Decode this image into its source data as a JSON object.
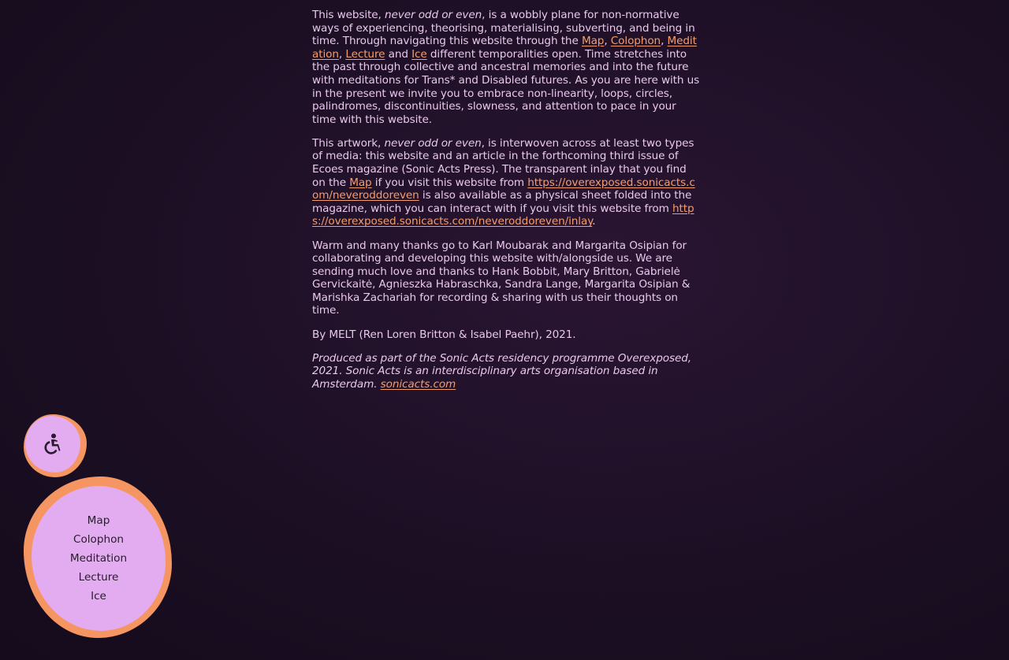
{
  "intro": {
    "p1_a": "This website, ",
    "p1_em": "never odd or even",
    "p1_b": ", is a wobbly plane for non-normative ways of experiencing, theorising, materialising, subverting, and being in time. Through navigating this website through the ",
    "p1_link_map": "Map",
    "p1_sep1": ", ",
    "p1_link_colophon": "Colophon",
    "p1_sep2": ", ",
    "p1_link_meditation": "Meditation",
    "p1_sep3": ", ",
    "p1_link_lecture": "Lecture",
    "p1_and": " and ",
    "p1_link_ice": "Ice",
    "p1_c": " different temporalities open. Time stretches into the past through collective and ancestral memories and into the future with meditations for Trans* and Disabled futures. As you are here with us in the present we invite you to embrace non-linearity, loops, circles, palindromes, discontinuities, slowness, and attention to pace in your time with this website.",
    "p2_a": "This artwork, ",
    "p2_em": "never odd or even",
    "p2_b": ", is interwoven across at least two types of media: this website and an article in the forthcoming third issue of Ecoes magazine (Sonic Acts Press). The transparent inlay that you find on the ",
    "p2_link_map": "Map",
    "p2_c": " if you visit this website from ",
    "p2_link_url1": "https://overexposed.sonicacts.com/neveroddoreven",
    "p2_d": " is also available as a physical sheet folded into the magazine, which you can interact with if you visit this website from ",
    "p2_link_url2": "https://overexposed.sonicacts.com/neveroddoreven/inlay",
    "p2_e": ".",
    "p3": "Warm and many thanks go to Karl Moubarak and Margarita Osipian for collaborating and developing this website with/alongside us. We are sending much love and thanks to Hank Bobbit, Mary Britton, Gabrielė Gervickaitė, Agnieszka Habraschka, Sandra Lange, Margarita Osipian & Marishka Zachariah for recording & sharing with us their thoughts on time.",
    "p4": "By MELT (Ren Loren Britton & Isabel Paehr), 2021.",
    "p5_a": "Produced as part of the Sonic Acts residency programme Overexposed, 2021. Sonic Acts is an interdisciplinary arts organisation based in Amsterdam. ",
    "p5_link": "sonicacts.com"
  },
  "accessibility": {
    "icon": "wheelchair-icon"
  },
  "nav": {
    "items": [
      "Map",
      "Colophon",
      "Meditation",
      "Lecture",
      "Ice"
    ]
  },
  "colors": {
    "background": "#1c0f24",
    "text": "#e8c8ec",
    "link": "#f59d6a",
    "blob_outer": "#f59662",
    "blob_inner": "#e3acf0"
  }
}
